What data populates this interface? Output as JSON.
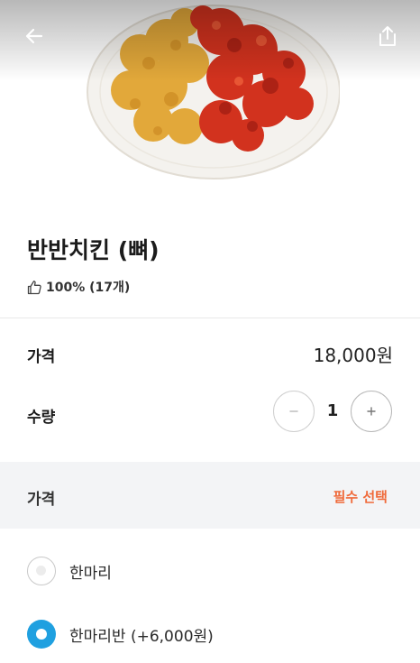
{
  "header": {
    "back_icon": "arrow-left-icon",
    "share_icon": "share-icon",
    "photo_icon": "half-half-chicken-photo"
  },
  "product": {
    "title": "반반치킨 (뼈)",
    "rating_icon": "thumbs-up-icon",
    "rating": "100% (17개)"
  },
  "details": {
    "price_label": "가격",
    "price_value": "18,000원",
    "quantity_label": "수량",
    "quantity_value": "1",
    "minus_label": "−",
    "plus_label": "+"
  },
  "options": {
    "section_title": "가격",
    "required_label": "필수 선택",
    "items": [
      {
        "label": "한마리",
        "selected": false
      },
      {
        "label": "한마리반 (+6,000원)",
        "selected": true
      }
    ]
  },
  "colors": {
    "accent_required": "#f06a3a",
    "radio_selected": "#1fa0e0",
    "section_bg": "#f3f4f6"
  }
}
